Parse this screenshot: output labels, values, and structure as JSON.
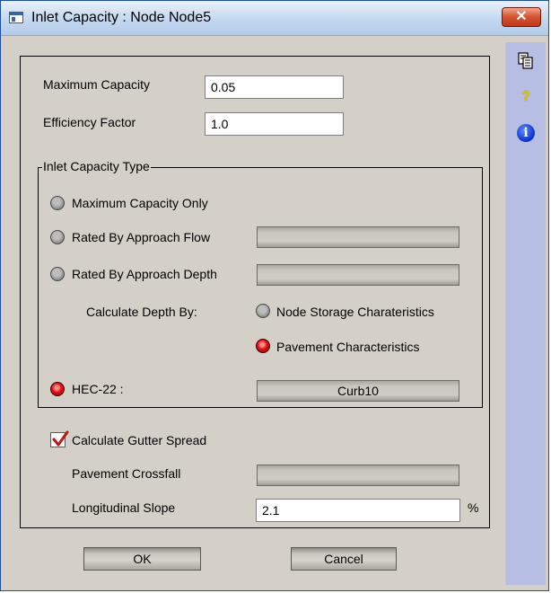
{
  "window": {
    "title": "Inlet Capacity : Node Node5",
    "close_glyph": "✕"
  },
  "side_toolbar": [
    {
      "icon": "copy-icon",
      "glyph": "⎘"
    },
    {
      "icon": "help-icon",
      "glyph": "?"
    },
    {
      "icon": "info-icon",
      "glyph": "i"
    }
  ],
  "fields": {
    "max_capacity": {
      "label": "Maximum Capacity",
      "value": "0.05"
    },
    "efficiency": {
      "label": "Efficiency Factor",
      "value": "1.0"
    }
  },
  "inlet_type": {
    "legend": "Inlet Capacity Type",
    "options": {
      "max_only": {
        "label": "Maximum Capacity Only",
        "checked": false
      },
      "approach_flow": {
        "label": "Rated By Approach Flow",
        "checked": false,
        "value": ""
      },
      "approach_depth": {
        "label": "Rated By Approach Depth",
        "checked": false,
        "value": ""
      },
      "hec22": {
        "label": "HEC-22 :",
        "checked": true,
        "value": "Curb10"
      }
    },
    "depth": {
      "label": "Calculate Depth By:",
      "node_storage": {
        "label": "Node Storage Charateristics",
        "checked": false
      },
      "pavement": {
        "label": "Pavement Characteristics",
        "checked": true
      }
    }
  },
  "gutter": {
    "checkbox_label": "Calculate Gutter Spread",
    "checked": true,
    "crossfall_label": "Pavement Crossfall",
    "crossfall_value": "",
    "slope_label": "Longitudinal Slope",
    "slope_value": "2.1",
    "slope_unit": "%"
  },
  "buttons": {
    "ok": "OK",
    "cancel": "Cancel"
  },
  "colors": {
    "title_bg": "#c4d8ef",
    "dialog_bg": "#d4d0c8",
    "strip_bg": "#b7bee3",
    "radio_selected": "#e01010",
    "close_button": "#d5512f"
  }
}
